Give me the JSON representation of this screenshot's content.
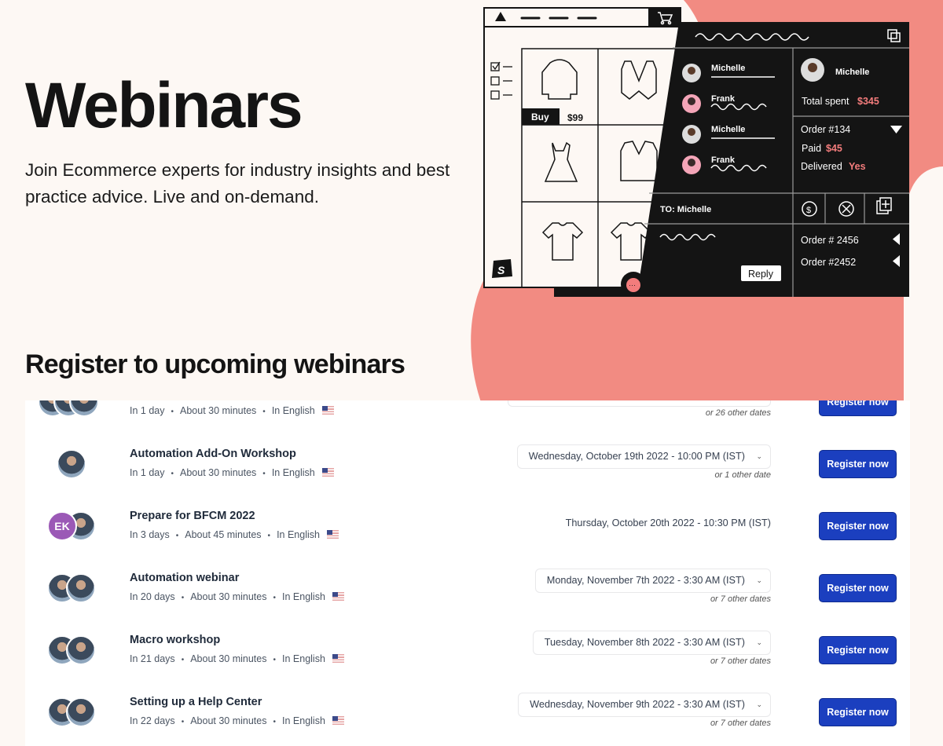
{
  "hero": {
    "title": "Webinars",
    "subtitle": "Join Ecommerce experts for industry insights and best practice advice. Live and on-demand."
  },
  "colors": {
    "background": "#fdf8f4",
    "blob": "#f28b82",
    "accent_button": "#1b3fbf",
    "illustration_pink": "#f37c7c"
  },
  "illustration": {
    "buy_label": "Buy",
    "price": "$99",
    "chat": [
      {
        "name": "Michelle"
      },
      {
        "name": "Frank"
      },
      {
        "name": "Michelle"
      },
      {
        "name": "Frank"
      }
    ],
    "customer": {
      "name": "Michelle",
      "total_label": "Total spent",
      "total_value": "$345"
    },
    "order": {
      "label": "Order #134",
      "paid_label": "Paid",
      "paid_value": "$45",
      "delivered_label": "Delivered",
      "delivered_value": "Yes"
    },
    "to_label": "TO: Michelle",
    "reply_label": "Reply",
    "orders": [
      "Order # 2456",
      "Order #2452"
    ]
  },
  "section_title": "Register to upcoming webinars",
  "webinars": [
    {
      "title": "",
      "when": "In 1 day",
      "duration": "About 30 minutes",
      "language": "In English",
      "date": "",
      "other_dates": "or 26 other dates",
      "button": "Register now"
    },
    {
      "title": "Automation Add-On Workshop",
      "when": "In 1 day",
      "duration": "About 30 minutes",
      "language": "In English",
      "date": "Wednesday, October 19th 2022 - 10:00 PM (IST)",
      "other_dates": "or 1 other date",
      "button": "Register now"
    },
    {
      "title": "Prepare for BFCM 2022",
      "when": "In 3 days",
      "duration": "About 45 minutes",
      "language": "In English",
      "date": "Thursday, October 20th 2022 - 10:30 PM (IST)",
      "other_dates": "",
      "button": "Register now",
      "avatar_initials": "EK"
    },
    {
      "title": "Automation webinar",
      "when": "In 20 days",
      "duration": "About 30 minutes",
      "language": "In English",
      "date": "Monday, November 7th 2022 - 3:30 AM (IST)",
      "other_dates": "or 7 other dates",
      "button": "Register now"
    },
    {
      "title": "Macro workshop",
      "when": "In 21 days",
      "duration": "About 30 minutes",
      "language": "In English",
      "date": "Tuesday, November 8th 2022 - 3:30 AM (IST)",
      "other_dates": "or 7 other dates",
      "button": "Register now"
    },
    {
      "title": "Setting up a Help Center",
      "when": "In 22 days",
      "duration": "About 30 minutes",
      "language": "In English",
      "date": "Wednesday, November 9th 2022 - 3:30 AM (IST)",
      "other_dates": "or 7 other dates",
      "button": "Register now"
    }
  ]
}
